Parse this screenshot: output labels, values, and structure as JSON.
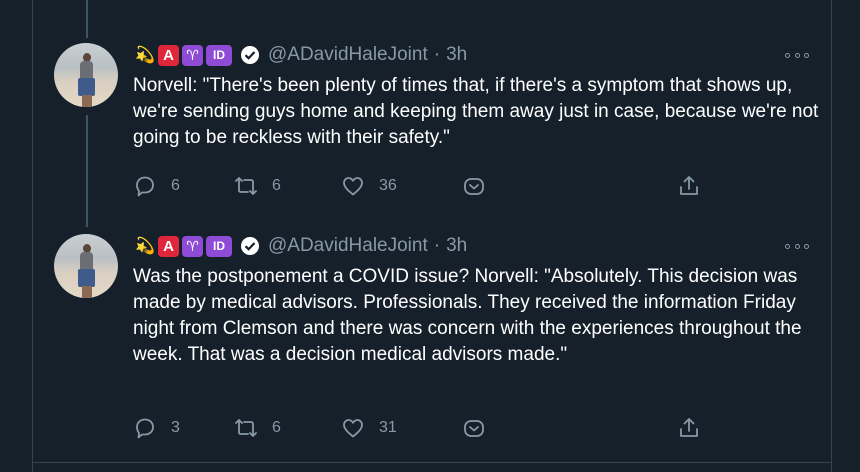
{
  "tweets": [
    {
      "emoji": "💫",
      "badge_a": "A",
      "badge_aries": "♈",
      "badge_id": "ID",
      "handle": "@ADavidHaleJoint",
      "separator": "·",
      "time": "3h",
      "text": "Norvell: \"There's been plenty of times that, if there's a symptom that shows up, we're sending guys home and keeping them away just in case, because we're not going to be reckless with their safety.\"",
      "replies": "6",
      "retweets": "6",
      "likes": "36"
    },
    {
      "emoji": "💫",
      "badge_a": "A",
      "badge_aries": "♈",
      "badge_id": "ID",
      "handle": "@ADavidHaleJoint",
      "separator": "·",
      "time": "3h",
      "text": "Was the postponement a COVID issue? Norvell: \"Absolutely. This decision was made by medical advisors. Professionals. They received the information Friday night from Clemson and there was concern with the experiences throughout the week. That was a decision medical advisors made.\"",
      "replies": "3",
      "retweets": "6",
      "likes": "31"
    }
  ],
  "colors": {
    "background": "#15202b",
    "secondary_text": "#8899a6",
    "thread_line": "#3d5466",
    "border": "#38444d"
  }
}
